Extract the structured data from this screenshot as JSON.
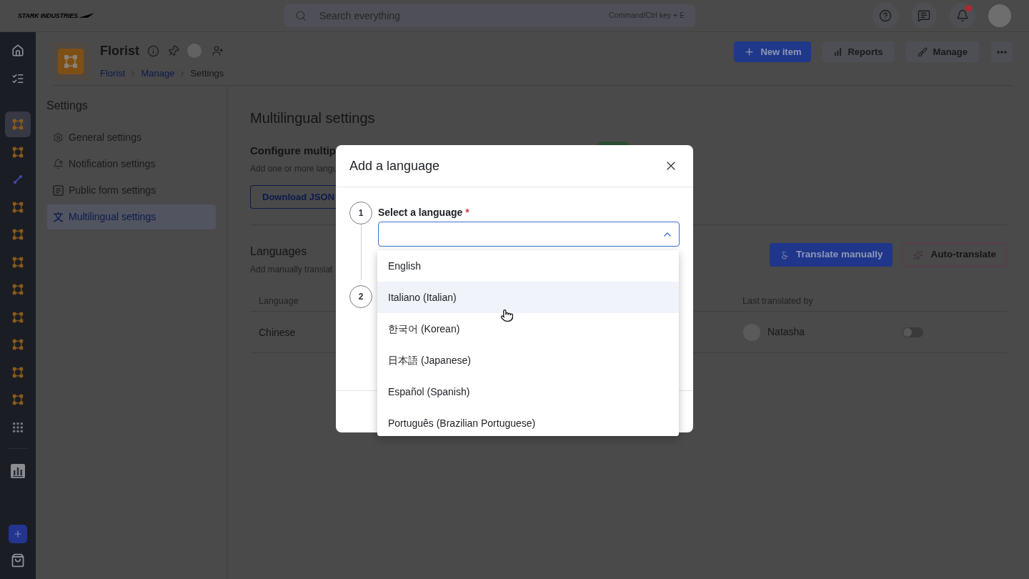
{
  "topbar": {
    "logo": "STARK INDUSTRIES",
    "search": {
      "placeholder": "Search everything",
      "shortcut": "Command/Ctrl key + E"
    },
    "bell": {
      "unread": true
    }
  },
  "rail": {
    "top": [
      {
        "kind": "home",
        "selected": false
      },
      {
        "kind": "tasks",
        "selected": false
      }
    ],
    "apps": [
      {
        "kind": "app",
        "selected": true
      },
      {
        "kind": "app",
        "selected": false
      },
      {
        "kind": "link",
        "selected": false
      },
      {
        "kind": "app",
        "selected": false
      },
      {
        "kind": "app",
        "selected": false
      },
      {
        "kind": "app",
        "selected": false
      },
      {
        "kind": "app",
        "selected": false
      },
      {
        "kind": "app",
        "selected": false
      },
      {
        "kind": "app",
        "selected": false
      },
      {
        "kind": "app",
        "selected": false
      },
      {
        "kind": "app",
        "selected": false
      },
      {
        "kind": "apps",
        "selected": false
      }
    ],
    "tools": [
      {
        "kind": "reports",
        "selected": false
      }
    ],
    "bottom": [
      {
        "kind": "add"
      },
      {
        "kind": "store"
      }
    ]
  },
  "header": {
    "title": "Florist",
    "breadcrumb": [
      {
        "label": "Florist",
        "kind": "link"
      },
      {
        "label": "Manage",
        "kind": "link"
      },
      {
        "label": "Settings",
        "kind": "current"
      }
    ],
    "actions": [
      {
        "label": "New item",
        "kind": "primary"
      },
      {
        "label": "Reports",
        "kind": "secondary"
      },
      {
        "label": "Manage",
        "kind": "secondary"
      }
    ]
  },
  "settings_nav": {
    "title": "Settings",
    "items": [
      {
        "label": "General settings",
        "selected": false
      },
      {
        "label": "Notification settings",
        "selected": false
      },
      {
        "label": "Public form settings",
        "selected": false
      },
      {
        "label": "Multilingual settings",
        "selected": true
      }
    ]
  },
  "main": {
    "title": "Multilingual settings",
    "configure": {
      "title": "Configure multip",
      "description": "Add one or more langu",
      "button": "Download JSON",
      "toggle": {
        "on": true
      }
    },
    "languages": {
      "title": "Languages",
      "description": "Add manually translat",
      "buttons": [
        {
          "label": "Translate manually",
          "kind": "primary"
        },
        {
          "label": "Auto-translate",
          "kind": "outline"
        }
      ],
      "table": {
        "columns": [
          "Language",
          "Last translated by"
        ],
        "rows": [
          {
            "language": "Chinese",
            "last_translated_by": "Natasha",
            "enabled": false
          }
        ]
      }
    }
  },
  "modal": {
    "title": "Add a language",
    "steps": [
      {
        "number": "1",
        "label": "Select a language",
        "required_mark": "*"
      },
      {
        "number": "2"
      }
    ],
    "select": {
      "expanded": true,
      "options": [
        {
          "label": "English",
          "highlighted": false
        },
        {
          "label": "Italiano (Italian)",
          "highlighted": true
        },
        {
          "label": "한국어 (Korean)",
          "highlighted": false
        },
        {
          "label": "日本語 (Japanese)",
          "highlighted": false
        },
        {
          "label": "Español (Spanish)",
          "highlighted": false
        },
        {
          "label": "Português (Brazilian Portuguese)",
          "highlighted": false
        }
      ]
    }
  }
}
